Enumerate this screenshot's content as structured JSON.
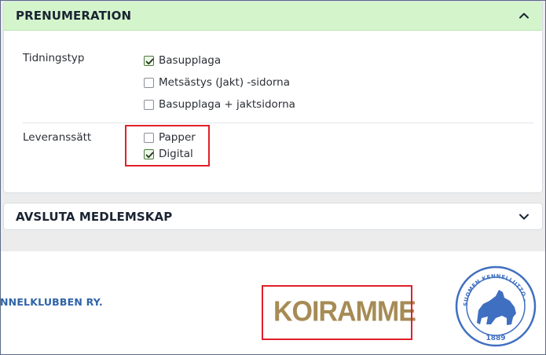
{
  "subscription": {
    "title": "PRENUMERATION",
    "newspaper_type_label": "Tidningstyp",
    "newspaper_options": [
      {
        "label": "Basupplaga",
        "checked": true
      },
      {
        "label": "Metsästys (Jakt) -sidorna",
        "checked": false
      },
      {
        "label": "Basupplaga + jaktsidorna",
        "checked": false
      }
    ],
    "delivery_label": "Leveranssätt",
    "delivery_options": [
      {
        "label": "Papper",
        "checked": false
      },
      {
        "label": "Digital",
        "checked": true
      }
    ]
  },
  "end_membership": {
    "title": "AVSLUTA MEDLEMSKAP"
  },
  "footer": {
    "club_text": "NNELKLUBBEN RY.",
    "koiramme_logo": "KOIRAMME",
    "seal_text_top": "SUOMEN KENNELLIITTO – FINSKA KENNELKLUBBEN RY",
    "seal_year": "1889"
  },
  "colors": {
    "header_green": "#d4f5cc",
    "highlight_red": "#e0202a",
    "logo_gold": "#a68b55",
    "seal_blue": "#3f6fc0",
    "link_blue": "#2e63a8"
  },
  "icons": {
    "expanded": "chevron-up-icon",
    "collapsed": "chevron-down-icon",
    "checked": "check-icon"
  }
}
